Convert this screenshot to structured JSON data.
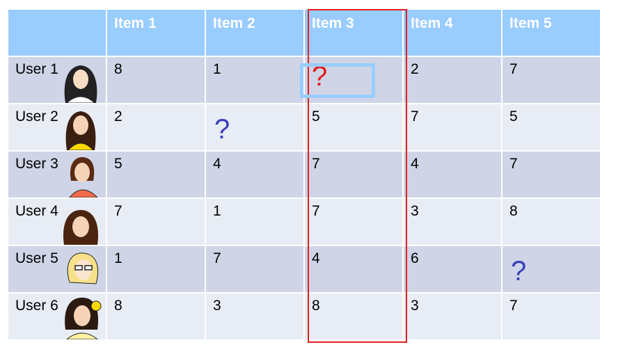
{
  "header": {
    "corner": "",
    "items": [
      "Item 1",
      "Item 2",
      "Item 3",
      "Item 4",
      "Item 5"
    ]
  },
  "rows": [
    {
      "user": "User 1",
      "values": [
        "8",
        "1",
        "?",
        "2",
        "7"
      ]
    },
    {
      "user": "User 2",
      "values": [
        "2",
        "?",
        "5",
        "7",
        "5"
      ]
    },
    {
      "user": "User 3",
      "values": [
        "5",
        "4",
        "7",
        "4",
        "7"
      ]
    },
    {
      "user": "User 4",
      "values": [
        "7",
        "1",
        "7",
        "3",
        "8"
      ]
    },
    {
      "user": "User 5",
      "values": [
        "1",
        "7",
        "4",
        "6",
        "?"
      ]
    },
    {
      "user": "User 6",
      "values": [
        "8",
        "3",
        "8",
        "3",
        "7"
      ]
    }
  ],
  "colors": {
    "header_bg": "#99ccff",
    "row_dark": "#cfd5e7",
    "row_light": "#e8ecf4",
    "highlight_column": "#e02020",
    "target_cell": "#99ccff",
    "question_red": "#e21a1a",
    "question_blue": "#3a3fbf"
  },
  "highlighted_column": "Item 3",
  "avatars": [
    "woman-portrait-icon",
    "woman-portrait-icon",
    "woman-portrait-icon",
    "woman-portrait-icon",
    "woman-portrait-icon",
    "woman-portrait-icon"
  ]
}
